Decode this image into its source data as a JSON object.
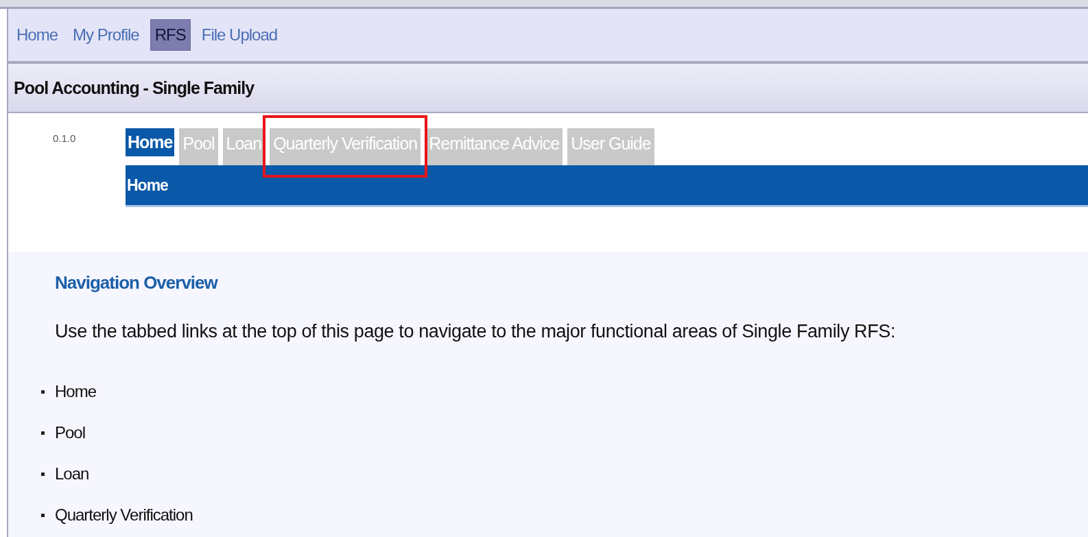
{
  "top_nav": [
    {
      "label": "Home",
      "selected": false
    },
    {
      "label": "My Profile",
      "selected": false
    },
    {
      "label": "RFS",
      "selected": true
    },
    {
      "label": "File Upload",
      "selected": false
    }
  ],
  "page_title": "Pool Accounting - Single Family",
  "version": "0.1.0",
  "tabs": [
    {
      "label": "Home",
      "selected": true,
      "highlighted": false
    },
    {
      "label": "Pool",
      "selected": false,
      "highlighted": false
    },
    {
      "label": "Loan",
      "selected": false,
      "highlighted": false
    },
    {
      "label": "Quarterly Verification",
      "selected": false,
      "highlighted": true
    },
    {
      "label": "Remittance Advice",
      "selected": false,
      "highlighted": false
    },
    {
      "label": "User Guide",
      "selected": false,
      "highlighted": false
    }
  ],
  "sub_bar": {
    "label": "Home"
  },
  "overview": {
    "heading": "Navigation Overview",
    "text": "Use the tabbed links at the top of this page to navigate to the major functional areas of Single Family RFS:",
    "items": [
      "Home",
      "Pool",
      "Loan",
      "Quarterly Verification"
    ]
  }
}
